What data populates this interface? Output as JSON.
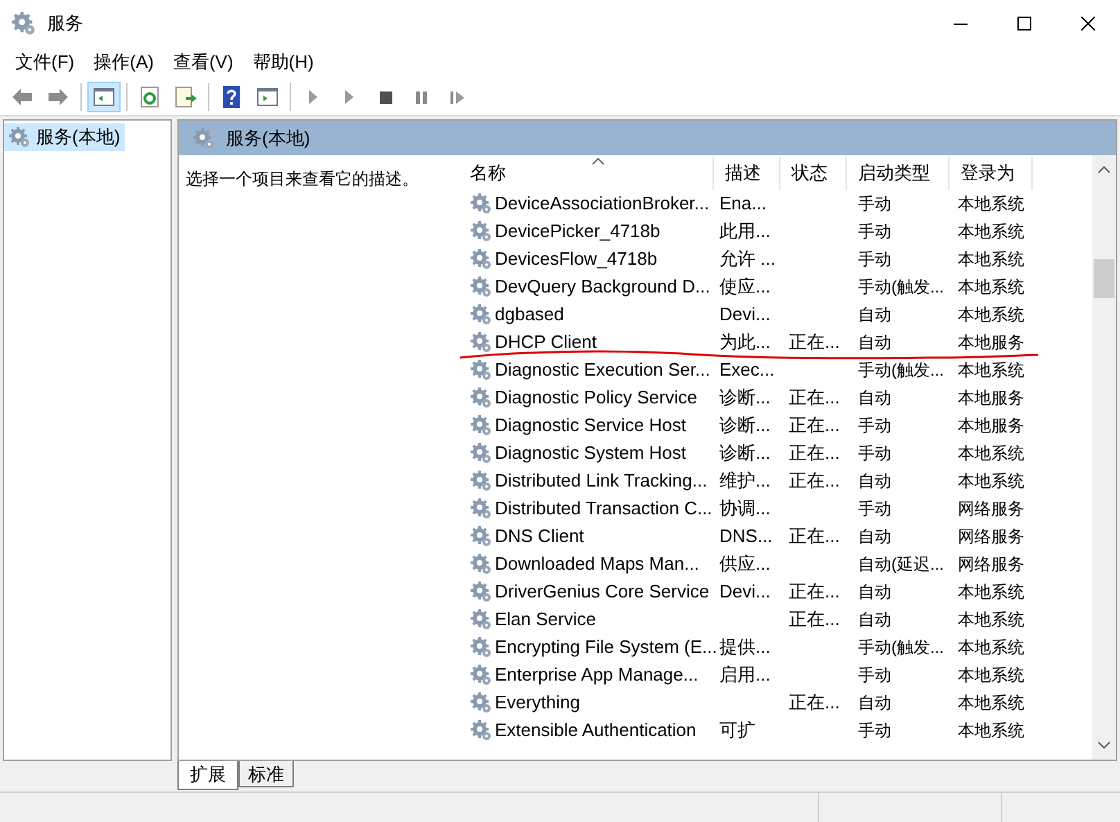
{
  "window": {
    "title": "服务"
  },
  "menu": [
    "文件(F)",
    "操作(A)",
    "查看(V)",
    "帮助(H)"
  ],
  "toolbar": [
    {
      "kind": "back",
      "selected": false
    },
    {
      "kind": "forward",
      "selected": false
    },
    {
      "kind": "tree",
      "selected": true
    },
    {
      "kind": "refresh",
      "selected": false
    },
    {
      "kind": "export",
      "selected": false
    },
    {
      "kind": "help",
      "selected": false
    },
    {
      "kind": "panel",
      "selected": false
    },
    {
      "kind": "start",
      "selected": false
    },
    {
      "kind": "start",
      "selected": false
    },
    {
      "kind": "stop",
      "selected": false
    },
    {
      "kind": "pause",
      "selected": false
    },
    {
      "kind": "resume",
      "selected": false
    }
  ],
  "tree": [
    {
      "label": "服务(本地)",
      "selected": true
    }
  ],
  "pane": {
    "title": "服务(本地)",
    "description": "选择一个项目来查看它的描述。"
  },
  "table": {
    "columns": [
      "名称",
      "描述",
      "状态",
      "启动类型",
      "登录为"
    ],
    "rows": [
      {
        "name": "DeviceAssociationBroker...",
        "desc": "Ena...",
        "status": "",
        "startup": "手动",
        "logon": "本地系统",
        "underlined": false
      },
      {
        "name": "DevicePicker_4718b",
        "desc": "此用...",
        "status": "",
        "startup": "手动",
        "logon": "本地系统",
        "underlined": false
      },
      {
        "name": "DevicesFlow_4718b",
        "desc": "允许 ...",
        "status": "",
        "startup": "手动",
        "logon": "本地系统",
        "underlined": false
      },
      {
        "name": "DevQuery Background D...",
        "desc": "使应...",
        "status": "",
        "startup": "手动(触发...",
        "logon": "本地系统",
        "underlined": false
      },
      {
        "name": "dgbased",
        "desc": "Devi...",
        "status": "",
        "startup": "自动",
        "logon": "本地系统",
        "underlined": false
      },
      {
        "name": "DHCP Client",
        "desc": "为此...",
        "status": "正在...",
        "startup": "自动",
        "logon": "本地服务",
        "underlined": true
      },
      {
        "name": "Diagnostic Execution Ser...",
        "desc": "Exec...",
        "status": "",
        "startup": "手动(触发...",
        "logon": "本地系统",
        "underlined": false
      },
      {
        "name": "Diagnostic Policy Service",
        "desc": "诊断...",
        "status": "正在...",
        "startup": "自动",
        "logon": "本地服务",
        "underlined": false
      },
      {
        "name": "Diagnostic Service Host",
        "desc": "诊断...",
        "status": "正在...",
        "startup": "手动",
        "logon": "本地服务",
        "underlined": false
      },
      {
        "name": "Diagnostic System Host",
        "desc": "诊断...",
        "status": "正在...",
        "startup": "手动",
        "logon": "本地系统",
        "underlined": false
      },
      {
        "name": "Distributed Link Tracking...",
        "desc": "维护...",
        "status": "正在...",
        "startup": "自动",
        "logon": "本地系统",
        "underlined": false
      },
      {
        "name": "Distributed Transaction C...",
        "desc": "协调...",
        "status": "",
        "startup": "手动",
        "logon": "网络服务",
        "underlined": false
      },
      {
        "name": "DNS Client",
        "desc": "DNS...",
        "status": "正在...",
        "startup": "自动",
        "logon": "网络服务",
        "underlined": false
      },
      {
        "name": "Downloaded Maps Man...",
        "desc": "供应...",
        "status": "",
        "startup": "自动(延迟...",
        "logon": "网络服务",
        "underlined": false
      },
      {
        "name": "DriverGenius Core Service",
        "desc": "Devi...",
        "status": "正在...",
        "startup": "自动",
        "logon": "本地系统",
        "underlined": false
      },
      {
        "name": "Elan Service",
        "desc": "",
        "status": "正在...",
        "startup": "自动",
        "logon": "本地系统",
        "underlined": false
      },
      {
        "name": "Encrypting File System (E...",
        "desc": "提供...",
        "status": "",
        "startup": "手动(触发...",
        "logon": "本地系统",
        "underlined": false
      },
      {
        "name": "Enterprise App Manage...",
        "desc": "启用...",
        "status": "",
        "startup": "手动",
        "logon": "本地系统",
        "underlined": false
      },
      {
        "name": "Everything",
        "desc": "",
        "status": "正在...",
        "startup": "自动",
        "logon": "本地系统",
        "underlined": false
      },
      {
        "name": "Extensible Authentication",
        "desc": "可扩",
        "status": "",
        "startup": "手动",
        "logon": "本地系统",
        "underlined": false
      }
    ]
  },
  "tabs": [
    {
      "label": "扩展",
      "selected": true
    },
    {
      "label": "标准",
      "selected": false
    }
  ]
}
